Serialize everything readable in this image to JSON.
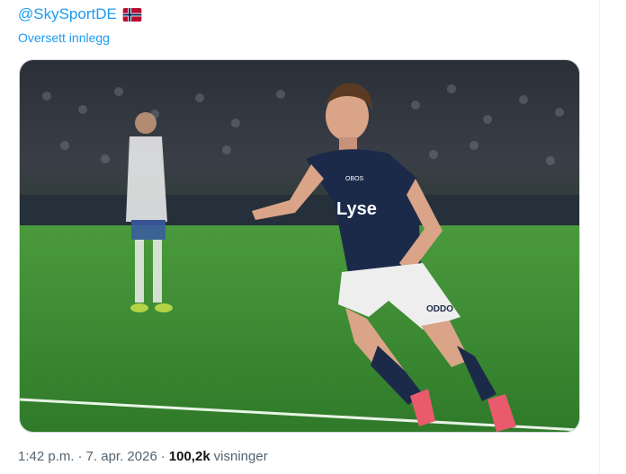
{
  "tweet": {
    "mention": "@SkySportDE",
    "flag_icon": "norway-flag-icon",
    "translate_label": "Oversett innlegg",
    "media": {
      "kit_sponsor": "Lyse",
      "chest_sponsor": "OBOS",
      "shorts_sponsor": "ODDO"
    },
    "time": "1:42 p.m.",
    "separator": "·",
    "date": "7. apr. 2026",
    "views_count": "100,2k",
    "views_label": "visninger"
  },
  "colors": {
    "link": "#1d9bf0",
    "meta_text": "#536471",
    "strong_text": "#0f1419",
    "pitch": "#3d8a34",
    "kit_navy": "#1c2a4a"
  }
}
